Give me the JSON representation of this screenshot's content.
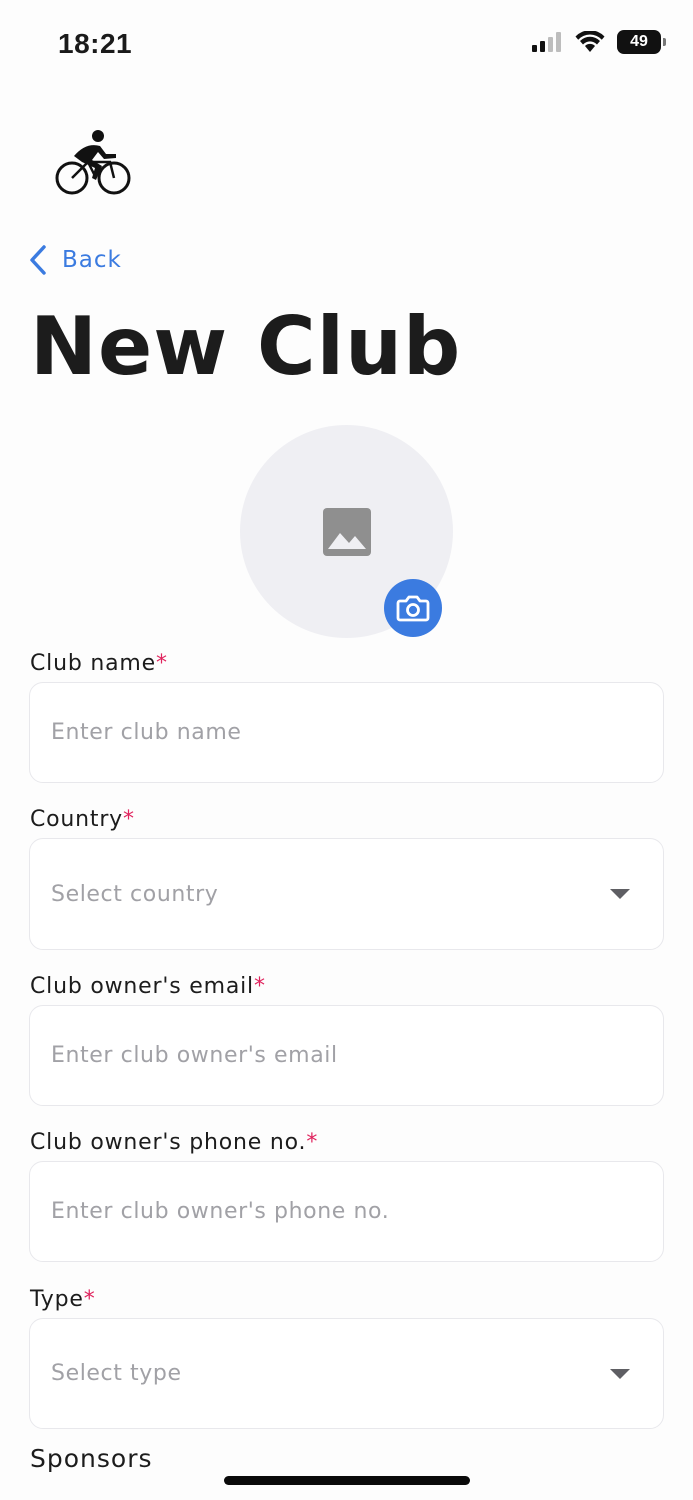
{
  "status_bar": {
    "time": "18:21",
    "battery": "49"
  },
  "nav": {
    "back_label": "Back"
  },
  "page": {
    "title": "New Club"
  },
  "colors": {
    "accent": "#3b7be0",
    "required": "#e0245e",
    "placeholder": "#a1a1a6"
  },
  "form": {
    "required_mark": "*",
    "club_name": {
      "label": "Club name",
      "placeholder": "Enter club name"
    },
    "country": {
      "label": "Country",
      "placeholder": "Select country"
    },
    "owner_email": {
      "label": "Club owner's email",
      "placeholder": "Enter club owner's email"
    },
    "owner_phone": {
      "label": "Club owner's phone no.",
      "placeholder": "Enter club owner's phone no."
    },
    "type": {
      "label": "Type",
      "placeholder": "Select type"
    },
    "sponsors": {
      "label": "Sponsors"
    }
  },
  "icons": [
    "back-chevron-icon",
    "image-placeholder-icon",
    "camera-icon",
    "dropdown-caret-icon",
    "cellular-signal-icon",
    "wifi-icon",
    "battery-icon",
    "cyclist-logo"
  ]
}
